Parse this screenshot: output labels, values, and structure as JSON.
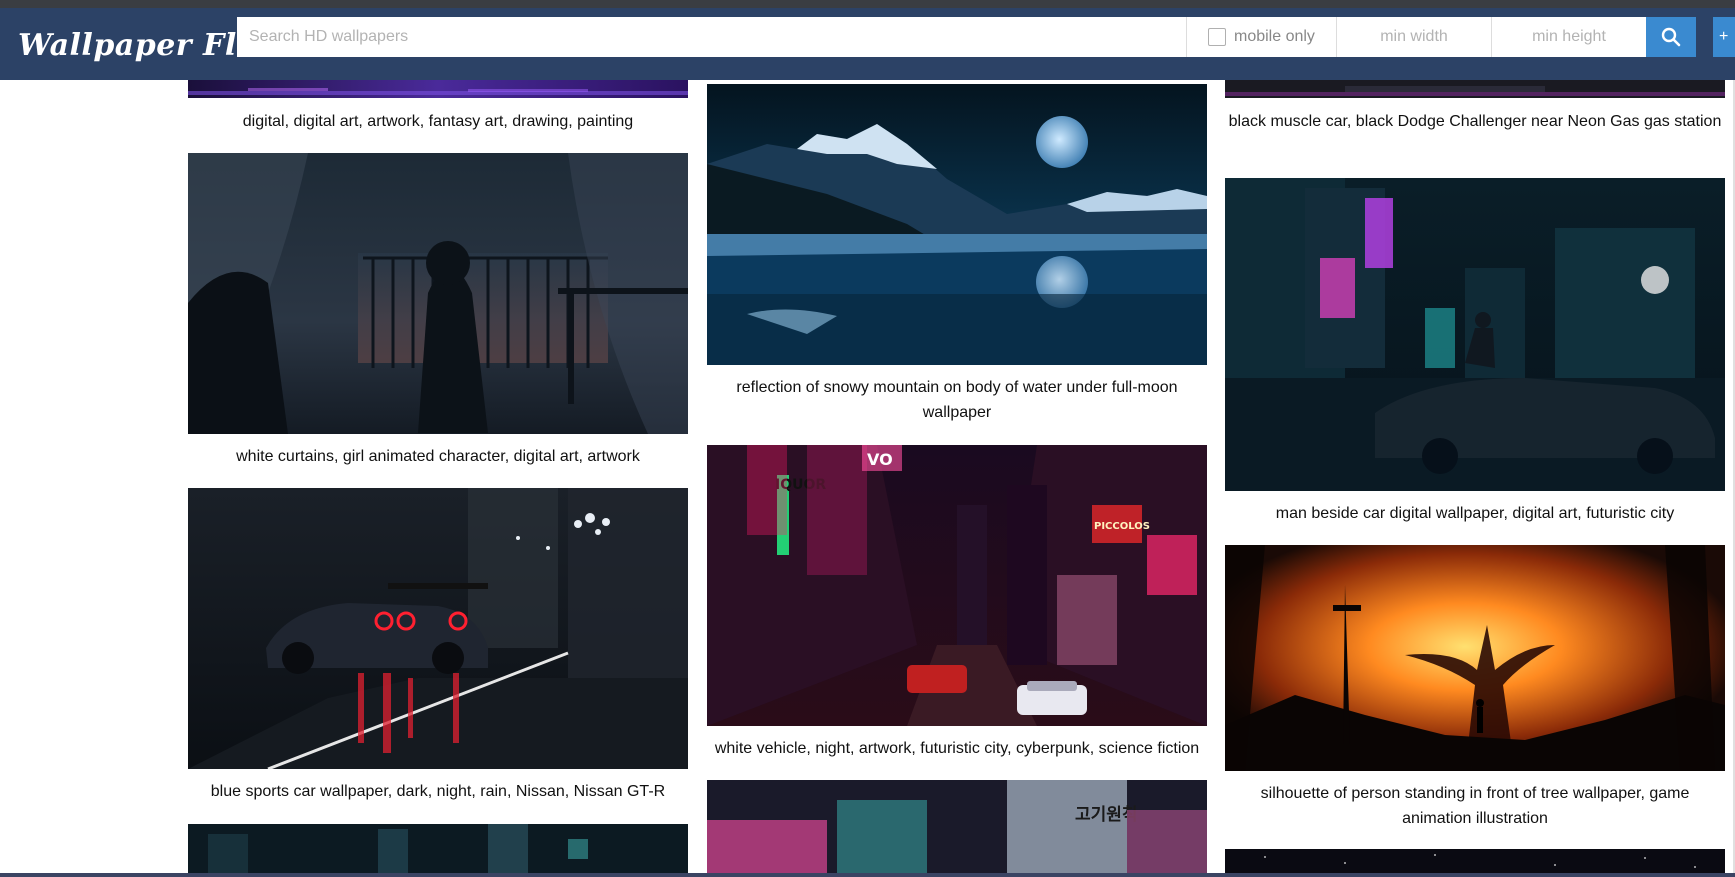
{
  "header": {
    "logo": "Wallpaper Flare",
    "search_placeholder": "Search HD wallpapers",
    "mobile_only_label": "mobile only",
    "min_width_placeholder": "min width",
    "min_height_placeholder": "min height"
  },
  "colors": {
    "header_bg": "#2c4266",
    "button_bg": "#3a8ad0"
  },
  "wallpapers": [
    {
      "caption": "digital, digital art, artwork, fantasy art, drawing, painting"
    },
    {
      "caption": "white curtains, girl animated character, digital art, artwork"
    },
    {
      "caption": "blue sports car wallpaper, dark, night, rain, Nissan, Nissan GT-R"
    },
    {
      "caption": ""
    },
    {
      "caption": "reflection of snowy mountain on body of water under full-moon wallpaper"
    },
    {
      "caption": "white vehicle, night, artwork, futuristic city, cyberpunk, science fiction"
    },
    {
      "caption": ""
    },
    {
      "caption": "black muscle car, black Dodge Challenger near Neon Gas gas station"
    },
    {
      "caption": "man beside car digital wallpaper, digital art, futuristic city"
    },
    {
      "caption": "silhouette of person standing in front of tree wallpaper, game animation illustration"
    },
    {
      "caption": ""
    }
  ],
  "image_texts": {
    "korean_sign": "고기원칙",
    "liquor_sign": "IQUOR",
    "vodka_sign": "VO",
    "piccolos_sign": "PICCOLOS"
  }
}
